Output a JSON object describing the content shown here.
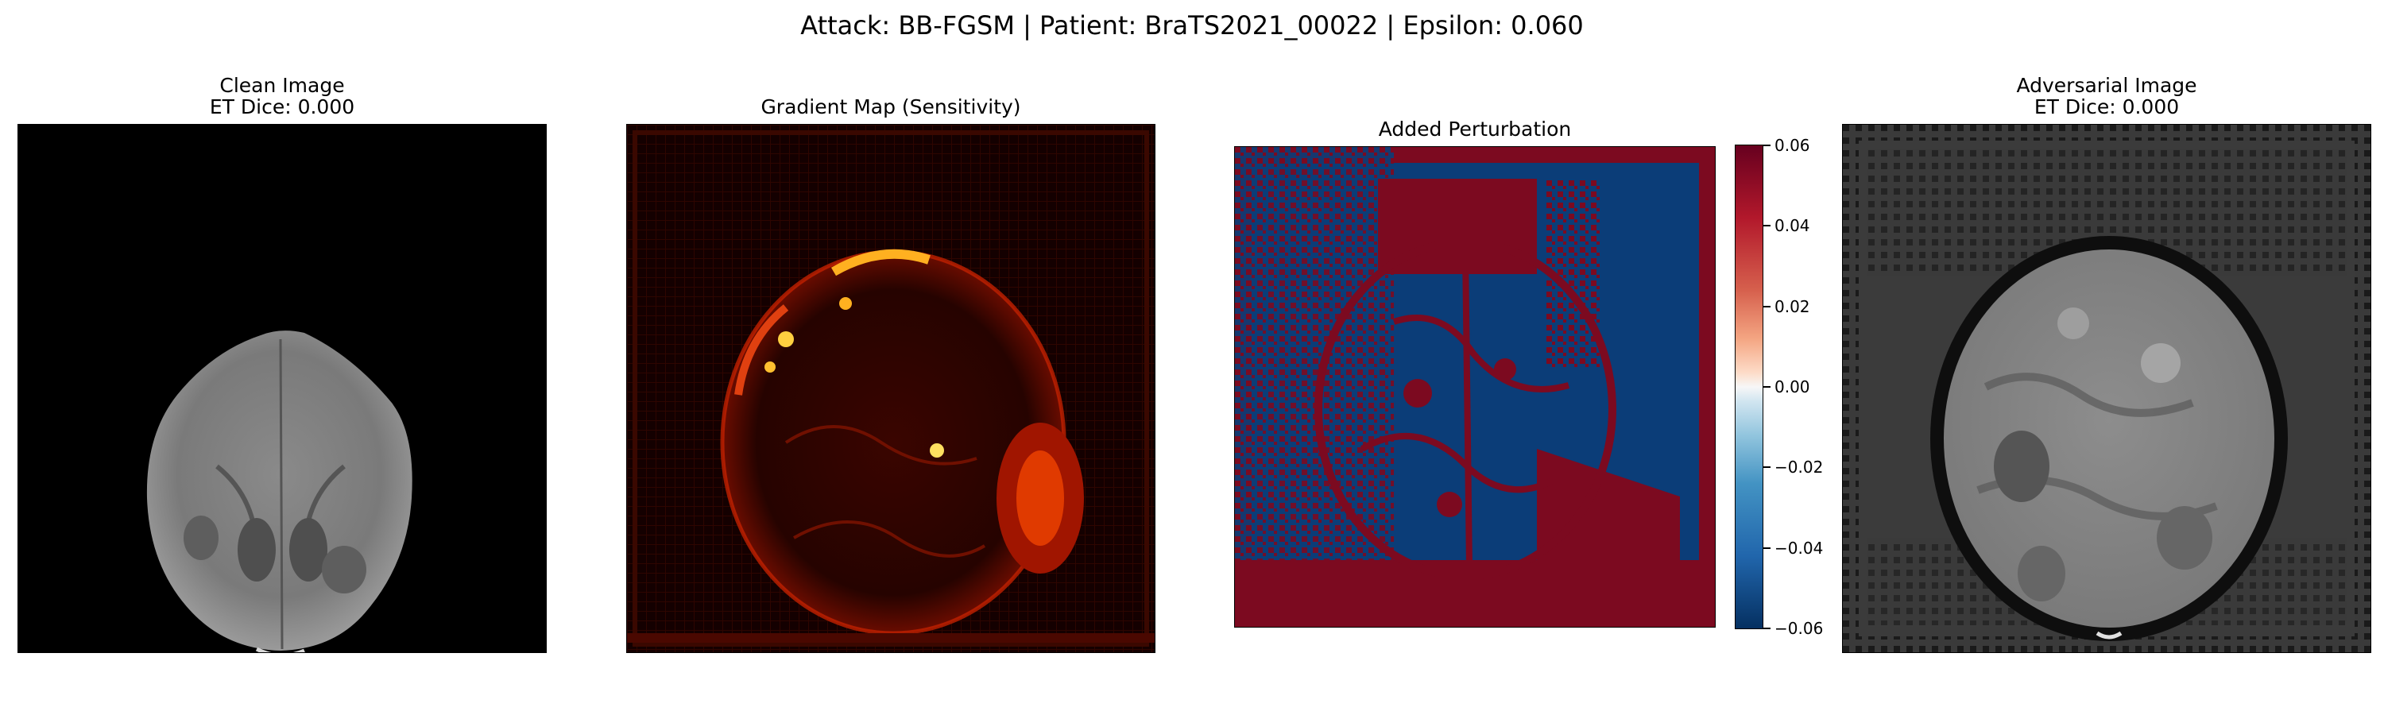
{
  "figure": {
    "title": "Attack: BB-FGSM | Patient: BraTS2021_00022 | Epsilon: 0.060"
  },
  "panels": {
    "clean": {
      "title": "Clean Image",
      "subtitle": "ET Dice: 0.000"
    },
    "gradient": {
      "title": "Gradient Map (Sensitivity)"
    },
    "perturbation": {
      "title": "Added Perturbation"
    },
    "adversarial": {
      "title": "Adversarial Image",
      "subtitle": "ET Dice: 0.000"
    }
  },
  "colorbar": {
    "colormap": "RdBu_r",
    "min": -0.06,
    "max": 0.06,
    "ticks": [
      "0.06",
      "0.04",
      "0.02",
      "0.00",
      "−0.02",
      "−0.04",
      "−0.06"
    ],
    "tick_values": [
      0.06,
      0.04,
      0.02,
      0.0,
      -0.02,
      -0.04,
      -0.06
    ]
  },
  "colors": {
    "positive": "#67001f",
    "negative": "#053061",
    "gradient_hot": "#ffcc33",
    "gradient_dark": "#000000"
  }
}
